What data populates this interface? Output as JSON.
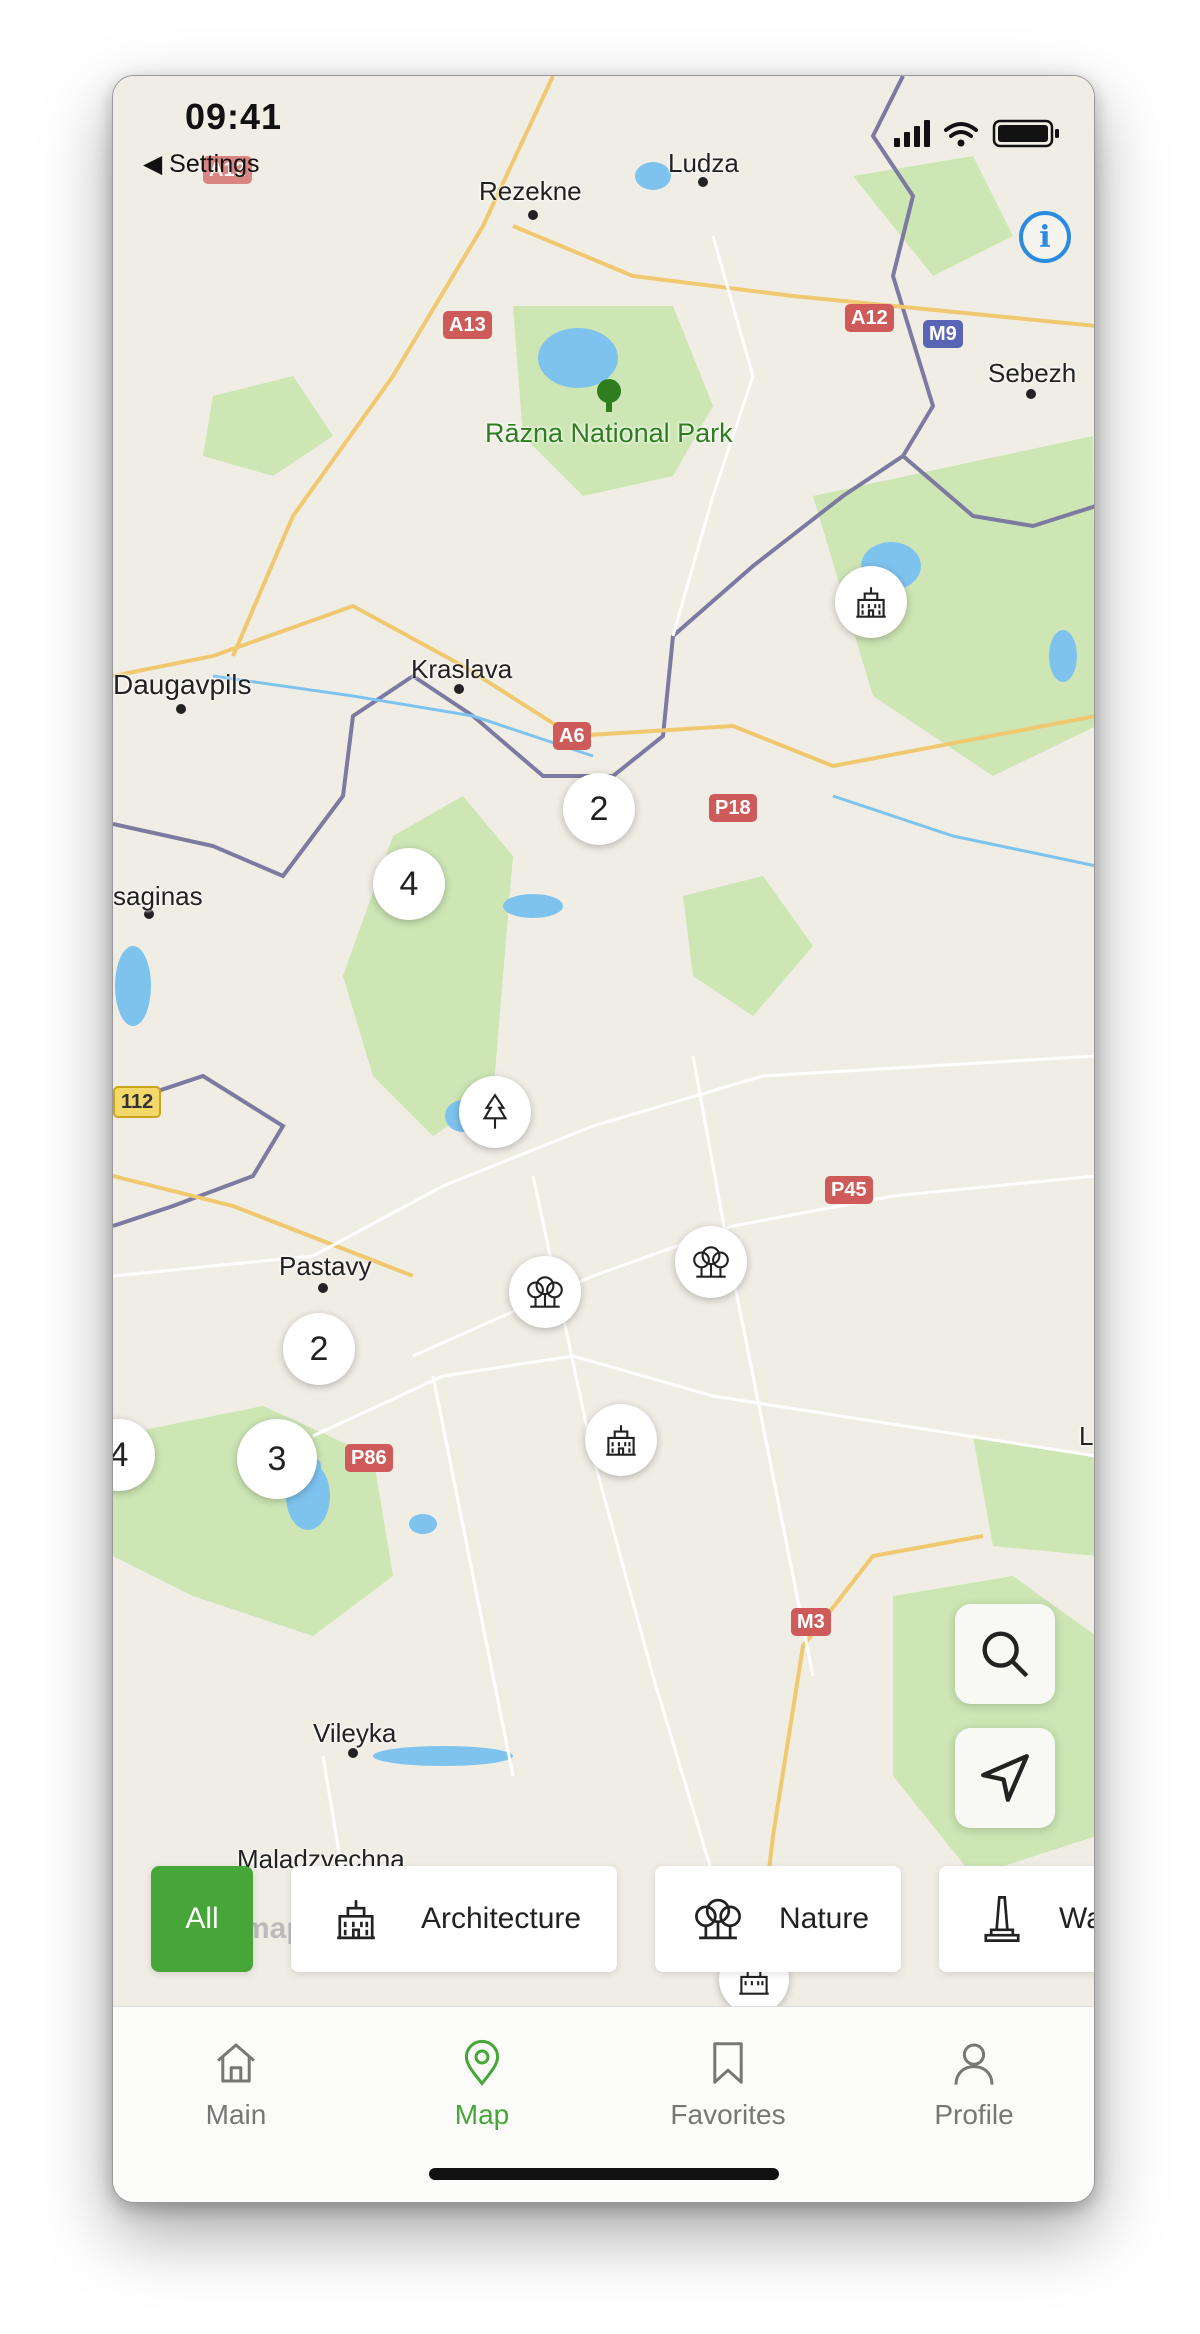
{
  "status_bar": {
    "time": "09:41",
    "back_label": "◀ Settings"
  },
  "map": {
    "places": {
      "rezekne": "Rezekne",
      "ludza": "Ludza",
      "razna": "Rāzna National Park",
      "sebezh": "Sebezh",
      "kraslava": "Kraslava",
      "daugavpils": "Daugavpils",
      "visaginas": "saginas",
      "pastavy": "Pastavy",
      "vileyka": "Vileyka",
      "maladzyechna": "Maladzyechna",
      "edge_l": "L"
    },
    "roads": {
      "a13": "A13",
      "a12": "A12",
      "m9": "M9",
      "a6": "A6",
      "p18": "P18",
      "p45": "P45",
      "p86": "P86",
      "m3": "M3",
      "a12_top": "A12",
      "n112": "112",
      "m_bottom": "M3"
    },
    "clusters": {
      "c1": "2",
      "c2": "4",
      "c3": "2",
      "c4": "3",
      "c5": "4"
    },
    "attribution": "mapbox"
  },
  "categories": [
    {
      "label": "All",
      "icon": "all"
    },
    {
      "label": "Architecture",
      "icon": "building-icon"
    },
    {
      "label": "Nature",
      "icon": "trees-icon"
    },
    {
      "label": "Wa",
      "icon": "monument-icon"
    }
  ],
  "tabs": [
    {
      "label": "Main",
      "icon": "home-icon"
    },
    {
      "label": "Map",
      "icon": "map-pin-icon"
    },
    {
      "label": "Favorites",
      "icon": "bookmark-icon"
    },
    {
      "label": "Profile",
      "icon": "user-icon"
    }
  ],
  "colors": {
    "accent": "#46a638",
    "info": "#2b8be0"
  }
}
